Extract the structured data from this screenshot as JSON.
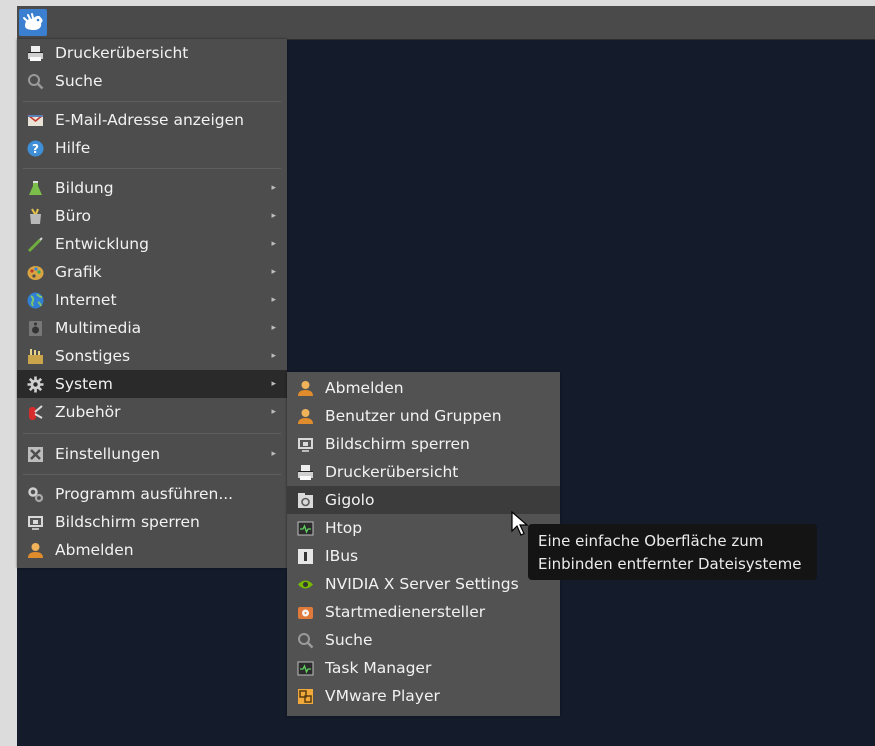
{
  "main_menu": {
    "items": [
      {
        "label": "Druckerübersicht",
        "icon": "printer-icon"
      },
      {
        "label": "Suche",
        "icon": "search-icon"
      },
      {
        "label": "E-Mail-Adresse anzeigen",
        "icon": "email-icon"
      },
      {
        "label": "Hilfe",
        "icon": "help-icon"
      },
      {
        "label": "Bildung",
        "icon": "education-icon",
        "arrow": "▸"
      },
      {
        "label": "Büro",
        "icon": "office-icon",
        "arrow": "▸"
      },
      {
        "label": "Entwicklung",
        "icon": "development-icon",
        "arrow": "▸"
      },
      {
        "label": "Grafik",
        "icon": "graphics-icon",
        "arrow": "▸"
      },
      {
        "label": "Internet",
        "icon": "globe-icon",
        "arrow": "▸"
      },
      {
        "label": "Multimedia",
        "icon": "multimedia-icon",
        "arrow": "▸"
      },
      {
        "label": "Sonstiges",
        "icon": "misc-icon",
        "arrow": "▸"
      },
      {
        "label": "System",
        "icon": "gear-icon",
        "arrow": "▸"
      },
      {
        "label": "Zubehör",
        "icon": "accessories-icon",
        "arrow": "▸"
      },
      {
        "label": "Einstellungen",
        "icon": "settings-icon",
        "arrow": "▸"
      },
      {
        "label": "Programm ausführen...",
        "icon": "run-program-icon"
      },
      {
        "label": "Bildschirm sperren",
        "icon": "lock-screen-icon"
      },
      {
        "label": "Abmelden",
        "icon": "logout-icon"
      }
    ]
  },
  "system_submenu": {
    "items": [
      {
        "label": "Abmelden",
        "icon": "logout-icon"
      },
      {
        "label": "Benutzer und Gruppen",
        "icon": "users-icon"
      },
      {
        "label": "Bildschirm sperren",
        "icon": "lock-screen-icon"
      },
      {
        "label": "Druckerübersicht",
        "icon": "printer-icon"
      },
      {
        "label": "Gigolo",
        "icon": "gigolo-icon"
      },
      {
        "label": "Htop",
        "icon": "terminal-monitor-icon"
      },
      {
        "label": "IBus",
        "icon": "ibus-icon"
      },
      {
        "label": "NVIDIA X Server Settings",
        "icon": "nvidia-icon"
      },
      {
        "label": "Startmedienersteller",
        "icon": "startup-disk-icon"
      },
      {
        "label": "Suche",
        "icon": "search-icon"
      },
      {
        "label": "Task Manager",
        "icon": "task-manager-icon"
      },
      {
        "label": "VMware Player",
        "icon": "vmware-icon"
      }
    ]
  },
  "tooltip": {
    "line1": "Eine einfache Oberfläche zum",
    "line2": "Einbinden entfernter Dateisysteme"
  },
  "colors": {
    "desktop": "#141c2c",
    "panel": "#4a4a4a",
    "menu": "#4d4d4d",
    "highlight": "#2a2a2a",
    "app_button": "#3b7fd0"
  }
}
